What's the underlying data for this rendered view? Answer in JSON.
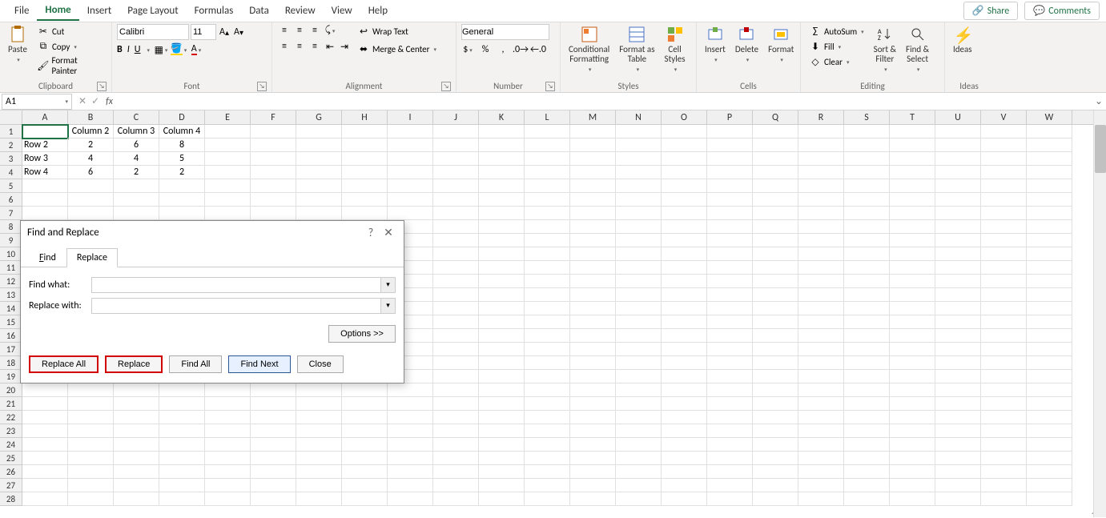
{
  "tabs": {
    "file": "File",
    "home": "Home",
    "insert": "Insert",
    "page_layout": "Page Layout",
    "formulas": "Formulas",
    "data": "Data",
    "review": "Review",
    "view": "View",
    "help": "Help"
  },
  "top_actions": {
    "share": "Share",
    "comments": "Comments"
  },
  "ribbon": {
    "clipboard": {
      "paste": "Paste",
      "cut": "Cut",
      "copy": "Copy",
      "format_painter": "Format Painter",
      "label": "Clipboard"
    },
    "font": {
      "name": "Calibri",
      "size": "11",
      "bold": "B",
      "italic": "I",
      "underline": "U",
      "label": "Font"
    },
    "alignment": {
      "wrap": "Wrap Text",
      "merge": "Merge & Center",
      "label": "Alignment"
    },
    "number": {
      "format": "General",
      "label": "Number"
    },
    "styles": {
      "cond": "Conditional\nFormatting",
      "table": "Format as\nTable",
      "cell": "Cell\nStyles",
      "label": "Styles"
    },
    "cells": {
      "insert": "Insert",
      "delete": "Delete",
      "format": "Format",
      "label": "Cells"
    },
    "editing": {
      "autosum": "AutoSum",
      "fill": "Fill",
      "clear": "Clear",
      "sort": "Sort &\nFilter",
      "find": "Find &\nSelect",
      "label": "Editing"
    },
    "ideas": {
      "ideas": "Ideas",
      "label": "Ideas"
    }
  },
  "name_box": "A1",
  "fx": "fx",
  "columns": [
    "A",
    "B",
    "C",
    "D",
    "E",
    "F",
    "G",
    "H",
    "I",
    "J",
    "K",
    "L",
    "M",
    "N",
    "O",
    "P",
    "Q",
    "R",
    "S",
    "T",
    "U",
    "V",
    "W"
  ],
  "row_numbers": [
    "1",
    "2",
    "3",
    "4",
    "5",
    "6",
    "7",
    "8",
    "9",
    "10",
    "11",
    "12",
    "13",
    "14",
    "15",
    "16",
    "17",
    "18",
    "19",
    "20",
    "21",
    "22",
    "23",
    "24",
    "25",
    "26",
    "27",
    "28"
  ],
  "sheet": {
    "r1": {
      "b": "Column 2",
      "c": "Column 3",
      "d": "Column 4"
    },
    "r2": {
      "a": "Row 2",
      "b": "2",
      "c": "6",
      "d": "8"
    },
    "r3": {
      "a": "Row 3",
      "b": "4",
      "c": "4",
      "d": "5"
    },
    "r4": {
      "a": "Row 4",
      "b": "6",
      "c": "2",
      "d": "2"
    }
  },
  "dialog": {
    "title": "Find and Replace",
    "tab_find": "Find",
    "tab_replace": "Replace",
    "find_what": "Find what:",
    "replace_with": "Replace with:",
    "find_value": "",
    "replace_value": "",
    "options": "Options >>",
    "replace_all": "Replace All",
    "replace": "Replace",
    "find_all": "Find All",
    "find_next": "Find Next",
    "close": "Close"
  }
}
